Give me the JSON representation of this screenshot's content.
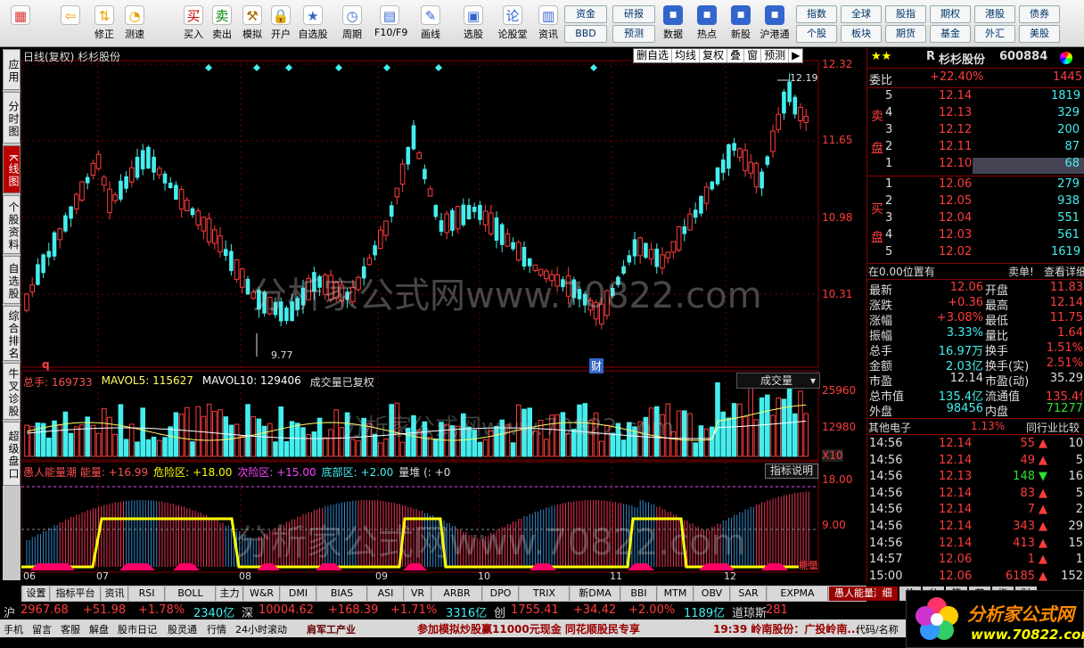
{
  "toolbar": {
    "buttons": [
      {
        "label": "",
        "icon": "windows-icon",
        "color": "#d33"
      },
      {
        "label": "",
        "icon": "back-arrow-icon",
        "color": "#e8a000"
      },
      {
        "label": "修正",
        "icon": "up-down-arrows-icon",
        "color": "#e8a000"
      },
      {
        "label": "测速",
        "icon": "stopwatch-icon",
        "color": "#e8a000"
      },
      {
        "label": "买入",
        "icon": "buy-icon",
        "color": "#c00"
      },
      {
        "label": "卖出",
        "icon": "sell-icon",
        "color": "#080"
      },
      {
        "label": "模拟",
        "icon": "hammer-icon",
        "color": "#a60"
      },
      {
        "label": "开户",
        "icon": "lock-icon",
        "color": "#a60"
      },
      {
        "label": "自选股",
        "icon": "star-icon",
        "color": "#36c"
      },
      {
        "label": "周期",
        "icon": "clock-icon",
        "color": "#36c"
      },
      {
        "label": "F10/F9",
        "icon": "document-icon",
        "color": "#36c"
      },
      {
        "label": "画线",
        "icon": "pencil-icon",
        "color": "#36c"
      },
      {
        "label": "选股",
        "icon": "monitor-icon",
        "color": "#36c"
      },
      {
        "label": "论股堂",
        "icon": "chat-icon",
        "color": "#36c"
      },
      {
        "label": "资讯",
        "icon": "news-icon",
        "color": "#36c"
      }
    ],
    "grid1": [
      [
        "资金",
        "研报"
      ],
      [
        "BBD",
        "预测"
      ]
    ],
    "right_icons": [
      {
        "label": "数据",
        "icon": "pe-icon"
      },
      {
        "label": "热点",
        "icon": "hot-icon"
      },
      {
        "label": "新股",
        "icon": "new-icon"
      },
      {
        "label": "沪港通",
        "icon": "sse-hke-icon"
      }
    ],
    "grid2": [
      [
        "指数",
        "全球",
        "股指",
        "期权",
        "港股",
        "债券"
      ],
      [
        "个股",
        "板块",
        "期货",
        "基金",
        "外汇",
        "美股"
      ]
    ]
  },
  "sidetabs": [
    "应用",
    "分时图",
    "K线图",
    "个股资料",
    "自选股",
    "综合排名",
    "牛叉诊股",
    "超级盘口"
  ],
  "kline": {
    "title": "日线(复权)  杉杉股份",
    "menu": [
      "删自选",
      "均线",
      "复权",
      "叠",
      "窗",
      "预测"
    ],
    "high_label": "12.19",
    "low_label": "9.77",
    "marker_q": "q",
    "marker_cai": "财",
    "watermark": "分析家公式网www.70822.com",
    "y_ticks": [
      "12.32",
      "11.65",
      "10.98",
      "10.31"
    ],
    "x_labels": [
      "06",
      "07",
      "08",
      "09",
      "10",
      "11",
      "12"
    ]
  },
  "volume": {
    "legend": [
      {
        "t": "总手: 169733",
        "c": "#ff5050"
      },
      {
        "t": "MAVOL5: 115627",
        "c": "#ffff66"
      },
      {
        "t": "MAVOL10: 129406",
        "c": "#fff"
      },
      {
        "t": "成交量已复权",
        "c": "#ddd"
      }
    ],
    "select": "成交量",
    "y_ticks": [
      "25960",
      "12980"
    ],
    "unit": "X10"
  },
  "indicator": {
    "legend": [
      {
        "t": "愚人能量潮 能量: +16.99",
        "c": "#ff5050"
      },
      {
        "t": "危险区: +18.00",
        "c": "#ff0"
      },
      {
        "t": "次险区: +15.00",
        "c": "#f4f"
      },
      {
        "t": "底部区: +2.00",
        "c": "#4ee"
      },
      {
        "t": "量堆 (: +0",
        "c": "#ddd"
      }
    ],
    "button": "指标说明",
    "y_ticks": [
      "18.00",
      "9.00"
    ],
    "tag": "能量"
  },
  "bottom_tabs": [
    "设置",
    "指标平台",
    "资讯",
    "RSI",
    "BOLL",
    "主力",
    "W&R",
    "DMI",
    "BIAS",
    "ASI",
    "VR",
    "ARBR",
    "DPO",
    "TRIX",
    "新DMA",
    "BBI",
    "MTM",
    "OBV",
    "SAR",
    "EXPMA",
    "愚人能量潮"
  ],
  "right_panel": {
    "stars": "★★",
    "code_prefix": "R",
    "name": "杉杉股份",
    "code": "600884",
    "weibi_label": "委比",
    "weibi": "+22.40%",
    "weibi_num": "1445",
    "sell": [
      {
        "n": "5",
        "p": "12.14",
        "v": "1819"
      },
      {
        "n": "4",
        "p": "12.13",
        "v": "329"
      },
      {
        "n": "3",
        "p": "12.12",
        "v": "200"
      },
      {
        "n": "2",
        "p": "12.11",
        "v": "87"
      },
      {
        "n": "1",
        "p": "12.10",
        "v": "68"
      }
    ],
    "buy": [
      {
        "n": "1",
        "p": "12.06",
        "v": "279"
      },
      {
        "n": "2",
        "p": "12.05",
        "v": "938"
      },
      {
        "n": "3",
        "p": "12.04",
        "v": "551"
      },
      {
        "n": "4",
        "p": "12.03",
        "v": "561"
      },
      {
        "n": "5",
        "p": "12.02",
        "v": "1619"
      }
    ],
    "sell_label": [
      "卖",
      "盘"
    ],
    "buy_label": [
      "买",
      "盘"
    ],
    "pos_note": "在0.00位置有",
    "sell_single": "卖单!",
    "view_detail": "查看详细",
    "stats": [
      [
        "最新",
        "12.06",
        "开盘",
        "11.83"
      ],
      [
        "涨跌",
        "+0.36",
        "最高",
        "12.14"
      ],
      [
        "涨幅",
        "+3.08%",
        "最低",
        "11.75"
      ],
      [
        "振幅",
        "3.33%",
        "量比",
        "1.64"
      ],
      [
        "总手",
        "16.97万",
        "换手",
        "1.51%"
      ],
      [
        "金额",
        "2.03亿",
        "换手(实)",
        "2.51%"
      ],
      [
        "市盈",
        "12.14",
        "市盈(动)",
        "35.29"
      ],
      [
        "总市值",
        "135.4亿",
        "流通值",
        "135.4亿"
      ],
      [
        "外盘",
        "98456",
        "内盘",
        "71277"
      ]
    ],
    "sector_label": "其他电子",
    "sector_pct": "1.13%",
    "compare": "同行业比较",
    "ticks": [
      {
        "t": "14:56",
        "p": "12.14",
        "v": "55",
        "d": "up",
        "n": "10"
      },
      {
        "t": "14:56",
        "p": "12.14",
        "v": "49",
        "d": "up",
        "n": "5"
      },
      {
        "t": "14:56",
        "p": "12.13",
        "v": "148",
        "d": "down",
        "n": "16"
      },
      {
        "t": "14:56",
        "p": "12.14",
        "v": "83",
        "d": "up",
        "n": "5"
      },
      {
        "t": "14:56",
        "p": "12.14",
        "v": "7",
        "d": "up",
        "n": "2"
      },
      {
        "t": "14:56",
        "p": "12.14",
        "v": "343",
        "d": "up",
        "n": "29"
      },
      {
        "t": "14:56",
        "p": "12.14",
        "v": "413",
        "d": "up",
        "n": "15"
      },
      {
        "t": "14:57",
        "p": "12.06",
        "v": "1",
        "d": "up",
        "n": "1"
      },
      {
        "t": "15:00",
        "p": "12.06",
        "v": "6185",
        "d": "up",
        "n": "152"
      }
    ],
    "tabs": [
      "细",
      "价",
      "分",
      "笔",
      "节",
      "指",
      "财"
    ]
  },
  "status1": [
    {
      "t": "沪",
      "c": "#ddd"
    },
    {
      "t": "2967.68",
      "c": "#ff3c3c"
    },
    {
      "t": "+51.98",
      "c": "#ff3c3c"
    },
    {
      "t": "+1.78%",
      "c": "#ff3c3c"
    },
    {
      "t": "2340亿",
      "c": "#4ee"
    },
    {
      "t": "深",
      "c": "#ddd"
    },
    {
      "t": "10004.62",
      "c": "#ff3c3c"
    },
    {
      "t": "+168.39",
      "c": "#ff3c3c"
    },
    {
      "t": "+1.71%",
      "c": "#ff3c3c"
    },
    {
      "t": "3316亿",
      "c": "#4ee"
    },
    {
      "t": "创",
      "c": "#ddd"
    },
    {
      "t": "1755.41",
      "c": "#ff3c3c"
    },
    {
      "t": "+34.42",
      "c": "#ff3c3c"
    },
    {
      "t": "+2.00%",
      "c": "#ff3c3c"
    },
    {
      "t": "1189亿",
      "c": "#4ee"
    },
    {
      "t": "道琼斯",
      "c": "#ddd"
    },
    {
      "t": "281",
      "c": "#ff3c3c"
    }
  ],
  "status2": {
    "left": [
      "手机",
      "留言",
      "客服",
      "解盘",
      "股市日记",
      "股灵通",
      "行情",
      "24小时滚动"
    ],
    "news": "肩军工产业",
    "ad": "参加模拟炒股赢11000元现金 同花顺股民专享",
    "time_news": "19:39 岭南股份：广投岭南...",
    "right": "代码/名称"
  },
  "logo": {
    "text": "分析家公式网",
    "url": "www.70822.com"
  }
}
